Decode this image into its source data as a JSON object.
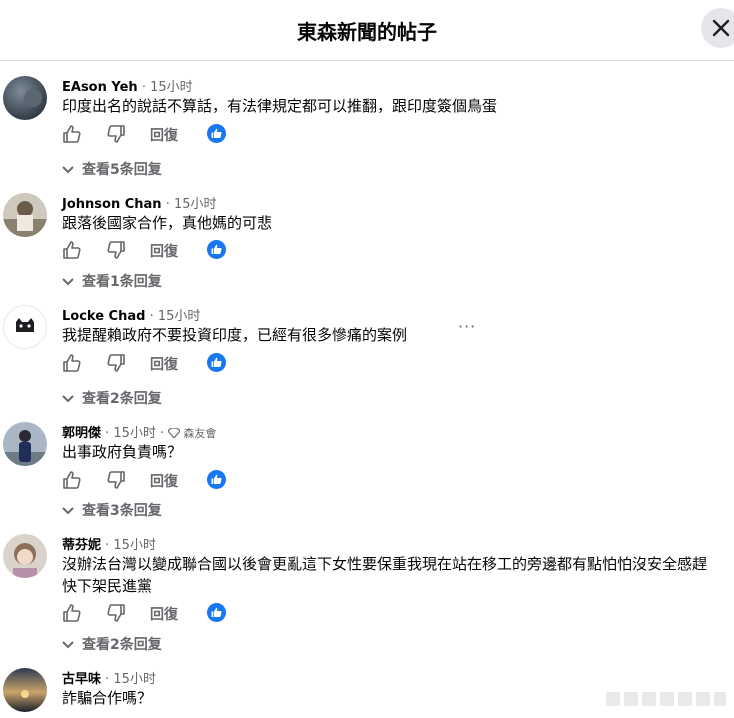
{
  "header": {
    "title": "東森新聞的帖子"
  },
  "actions": {
    "reply_label": "回復"
  },
  "comments": [
    {
      "author": "EAson Yeh",
      "time": " · 15小时",
      "text": "印度出名的說話不算話，有法律規定都可以推翻，跟印度簽個鳥蛋",
      "view_replies": "查看5条回复"
    },
    {
      "author": "Johnson Chan",
      "time": " · 15小时",
      "text": "跟落後國家合作，真他媽的可悲",
      "view_replies": "查看1条回复"
    },
    {
      "author": "Locke Chad",
      "time": " · 15小时",
      "text": "我提醒賴政府不要投資印度，已經有很多慘痛的案例",
      "view_replies": "查看2条回复",
      "more": "···"
    },
    {
      "author": "郭明傑",
      "time": " · 15小时 · ",
      "badge": "森友會",
      "text": "出事政府負責嗎？",
      "view_replies": "查看3条回复"
    },
    {
      "author": "蒂芬妮",
      "time": " · 15小时",
      "text": "沒辦法台灣以變成聯合國以後會更亂這下女性要保重我現在站在移工的旁邊都有點怕怕沒安全感趕快下架民進黨",
      "view_replies": "查看2条回复"
    },
    {
      "author": "古早味",
      "time": " · 15小时",
      "text": "詐騙合作嗎？"
    }
  ],
  "colors": {
    "accent": "#1877f2",
    "secondary_text": "#65676b",
    "divider": "#dddfe2"
  }
}
